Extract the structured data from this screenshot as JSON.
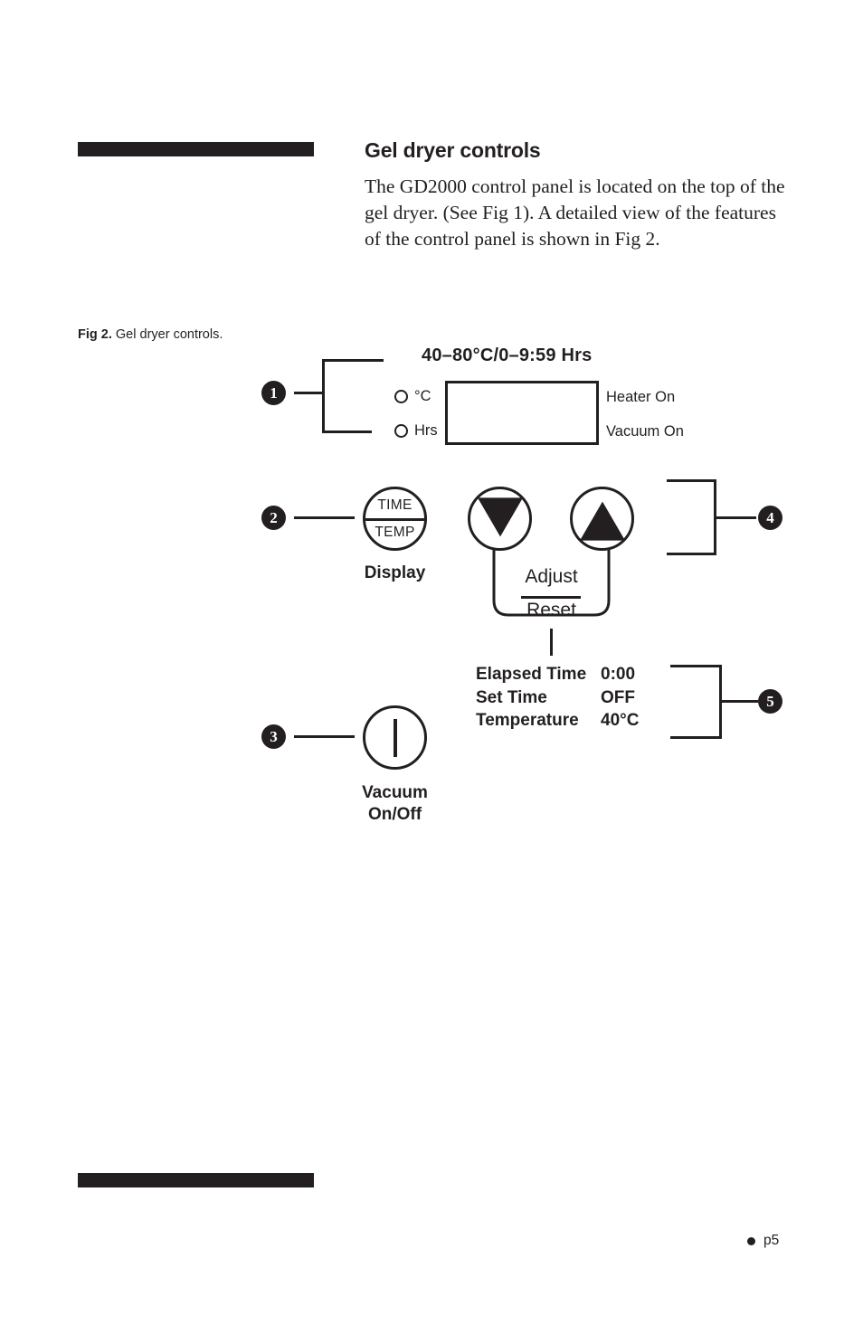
{
  "document": {
    "section_heading": "Gel dryer controls",
    "body_text": "The GD2000 control panel is located on the top of the gel dryer. (See Fig 1). A detailed view of the features of the control panel is shown in Fig 2.",
    "figure_caption_label": "Fig 2.",
    "figure_caption_text": "Gel dryer controls.",
    "page_marker": "p5",
    "ink_color": "#231f20",
    "paper_color": "#ffffff"
  },
  "callouts": {
    "one": "1",
    "two": "2",
    "three": "3",
    "four": "4",
    "five": "5"
  },
  "panel": {
    "range_label": "40–80°C/0–9:59 Hrs",
    "units": [
      {
        "indicator": "led-indicator",
        "label": "°C"
      },
      {
        "indicator": "led-indicator",
        "label": "Hrs"
      }
    ],
    "indicators": {
      "heater": "Heater On",
      "vacuum": "Vacuum On"
    },
    "display_button": {
      "top_label": "TIME",
      "bottom_label": "TEMP",
      "caption": "Display"
    },
    "adjust_buttons": {
      "down_icon": "triangle-down-icon",
      "up_icon": "triangle-up-icon",
      "numerator_label": "Adjust",
      "denominator_label": "Reset"
    },
    "vacuum_button": {
      "icon": "power-bar-icon",
      "caption_line1": "Vacuum",
      "caption_line2": "On/Off"
    },
    "status_readout": {
      "rows": [
        {
          "name": "Elapsed Time",
          "value": "0:00"
        },
        {
          "name": "Set Time",
          "value": "OFF"
        },
        {
          "name": "Temperature",
          "value": "40°C"
        }
      ]
    }
  }
}
